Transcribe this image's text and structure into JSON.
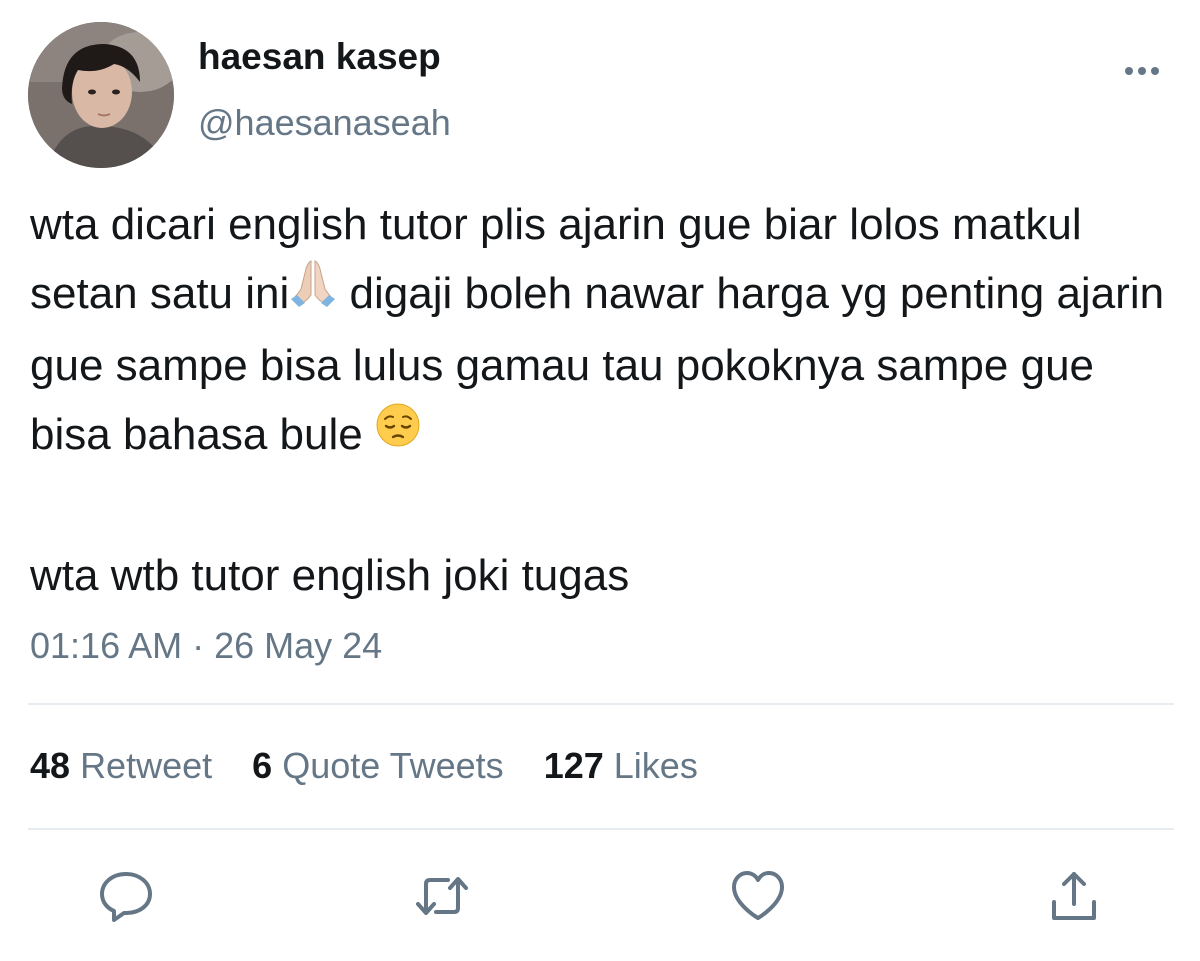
{
  "author": {
    "display_name": "haesan kasep",
    "handle": "@haesanaseah"
  },
  "tweet": {
    "paragraph1_part1": "wta dicari english tutor plis ajarin gue biar lolos matkul setan satu ini",
    "paragraph1_emoji1": "folded-hands-emoji",
    "paragraph1_part2": " digaji boleh nawar harga yg penting ajarin gue sampe bisa lulus gamau tau pokoknya sampe gue bisa bahasa bule ",
    "paragraph1_emoji2": "pensive-face-emoji",
    "paragraph2": "wta wtb tutor english joki tugas",
    "timestamp": "01:16 AM · 26 May 24"
  },
  "stats": {
    "retweets_count": "48",
    "retweets_label": "Retweet",
    "quotes_count": "6",
    "quotes_label": "Quote Tweets",
    "likes_count": "127",
    "likes_label": "Likes"
  },
  "actions": {
    "reply_icon": "reply-icon",
    "retweet_icon": "retweet-icon",
    "like_icon": "heart-icon",
    "share_icon": "share-icon",
    "more_icon": "more-options-icon"
  },
  "colors": {
    "text_primary": "#14171a",
    "text_secondary": "#657786",
    "divider": "#e6ecf0"
  }
}
